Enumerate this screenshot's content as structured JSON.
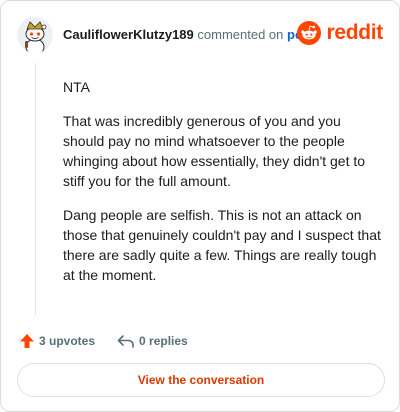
{
  "header": {
    "username": "CauliflowerKlutzy189",
    "action_text": "commented on",
    "post_link": "post",
    "logo_text": "reddit"
  },
  "comment": {
    "paragraphs": [
      "NTA",
      "That was incredibly generous of you and you should pay no mind whatsoever to the people whinging about how essentially, they didn't get to stiff you for the full amount.",
      "Dang people are selfish. This is not an attack on those that genuinely couldn't pay and I suspect that there are sadly quite a few. Things are really tough at the moment."
    ]
  },
  "actions": {
    "upvotes": "3 upvotes",
    "replies": "0 replies"
  },
  "cta": {
    "label": "View the conversation"
  },
  "colors": {
    "brand": "#ff4500",
    "link": "#0a66c2",
    "cta_text": "#d93900"
  },
  "icons": {
    "avatar": "snoo-avatar",
    "logo": "reddit-logo-icon",
    "upvote": "upvote-arrow-icon",
    "reply": "reply-arrow-icon"
  }
}
